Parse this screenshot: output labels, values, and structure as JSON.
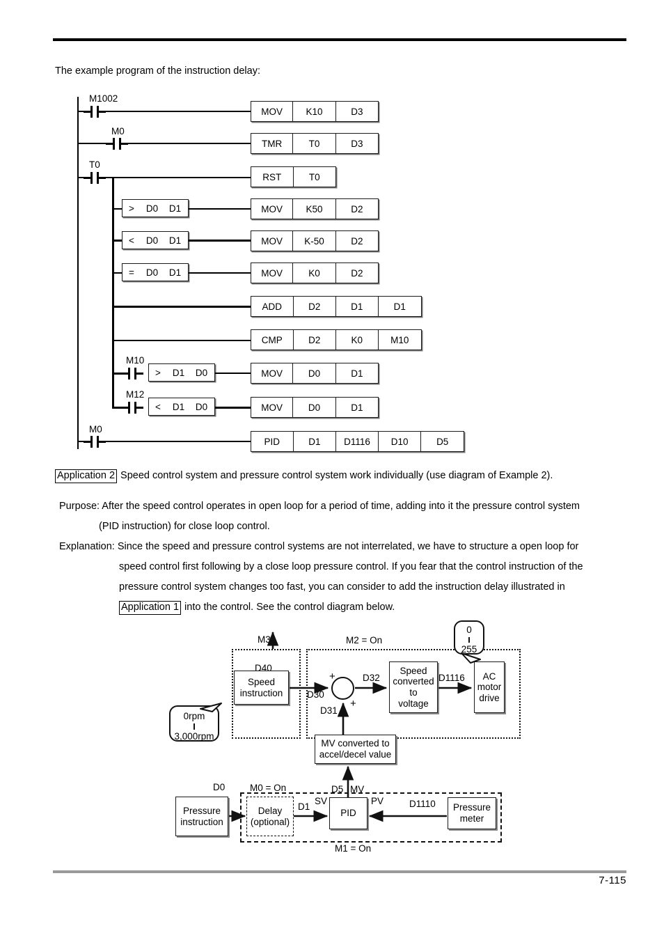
{
  "document": {
    "page_number": "7-115",
    "intro_text": "The example program of the instruction delay:"
  },
  "ladder": {
    "rungs": [
      {
        "contact_label": "M1002",
        "cells": [
          "MOV",
          "K10",
          "D3"
        ]
      },
      {
        "contact_label": "M0",
        "cells": [
          "TMR",
          "T0",
          "D3"
        ]
      },
      {
        "contact_label": "T0",
        "cells": [
          "RST",
          "T0"
        ]
      },
      {
        "contact_label": "",
        "compare": ">  D0   D1",
        "cells": [
          "MOV",
          "K50",
          "D2"
        ]
      },
      {
        "contact_label": "",
        "compare": "<  D0   D1",
        "cells": [
          "MOV",
          "K-50",
          "D2"
        ]
      },
      {
        "contact_label": "",
        "compare": "=  D0   D1",
        "cells": [
          "MOV",
          "K0",
          "D2"
        ]
      },
      {
        "contact_label": "",
        "cells": [
          "ADD",
          "D2",
          "D1",
          "D1"
        ]
      },
      {
        "contact_label": "",
        "cells": [
          "CMP",
          "D2",
          "K0",
          "M10"
        ]
      },
      {
        "contact_label": "M10",
        "compare": ">  D1   D0",
        "cells": [
          "MOV",
          "D0",
          "D1"
        ]
      },
      {
        "contact_label": "M12",
        "compare": "<  D1   D0",
        "cells": [
          "MOV",
          "D0",
          "D1"
        ]
      },
      {
        "contact_label": "M0",
        "cells": [
          "PID",
          "D1",
          "D1116",
          "D10",
          "D5"
        ]
      }
    ],
    "cell_labels": {
      "r1c1": "MOV",
      "r1c2": "K10",
      "r1c3": "D3",
      "r2c1": "TMR",
      "r2c2": "T0",
      "r2c3": "D3",
      "r3c1": "RST",
      "r3c2": "T0",
      "r4c1": "MOV",
      "r4c2": "K50",
      "r4c3": "D2",
      "r5c1": "MOV",
      "r5c2": "K-50",
      "r5c3": "D2",
      "r6c1": "MOV",
      "r6c2": "K0",
      "r6c3": "D2",
      "r7c1": "ADD",
      "r7c2": "D2",
      "r7c3": "D1",
      "r7c4": "D1",
      "r8c1": "CMP",
      "r8c2": "D2",
      "r8c3": "K0",
      "r8c4": "M10",
      "r9c1": "MOV",
      "r9c2": "D0",
      "r9c3": "D1",
      "r10c1": "MOV",
      "r10c2": "D0",
      "r10c3": "D1",
      "r11c1": "PID",
      "r11c2": "D1",
      "r11c3": "D1116",
      "r11c4": "D10",
      "r11c5": "D5"
    },
    "contacts": {
      "c1": "M1002",
      "c2": "M0",
      "c3": "T0",
      "c9": "M10",
      "c10": "M12",
      "c11": "M0"
    },
    "compare_boxes": {
      "b4_op": ">",
      "b4_a": "D0",
      "b4_b": "D1",
      "b5_op": "<",
      "b5_a": "D0",
      "b5_b": "D1",
      "b6_op": "=",
      "b6_a": "D0",
      "b6_b": "D1",
      "b9_op": ">",
      "b9_a": "D1",
      "b9_b": "D0",
      "b10_op": "<",
      "b10_a": "D1",
      "b10_b": "D0"
    }
  },
  "application2": {
    "tag": "Application 2",
    "headline": "Speed control system and pressure control system work individually (use diagram of Example 2).",
    "purpose_label": "Purpose:",
    "purpose_line1": "After the speed control operates in open loop for a period of time, adding into it the pressure control system",
    "purpose_line2": "(PID instruction) for close loop control.",
    "explanation_label": "Explanation:",
    "explanation_line1": "Since the speed and pressure control systems are not interrelated, we have to structure a open loop for",
    "explanation_line2": "speed control first following by a close loop pressure control. If you fear that the control instruction of the",
    "explanation_line3": "pressure control system changes too fast, you can consider to add the instruction delay illustrated in",
    "explanation_tag": "Application 1",
    "explanation_line4": "into the control. See the control diagram below."
  },
  "block_diagram": {
    "labels": {
      "m3": "M3",
      "m2_on": "M2 = On",
      "m0_on": "M0 = On",
      "m1_on": "M1 = On",
      "d40": "D40",
      "d30": "D30",
      "d31": "D31",
      "d32": "D32",
      "d1116": "D1116",
      "d0": "D0",
      "d1": "D1",
      "d5": "D5",
      "mv": "MV",
      "sv": "SV",
      "pv": "PV",
      "d1110": "D1110",
      "plus1": "+",
      "plus2": "+"
    },
    "boxes": {
      "speed_instruction": "Speed\ninstruction",
      "speed_instruction_l1": "Speed",
      "speed_instruction_l2": "instruction",
      "speed_converted_l1": "Speed",
      "speed_converted_l2": "converted",
      "speed_converted_l3": "to",
      "speed_converted_l4": "voltage",
      "ac_motor_l1": "AC",
      "ac_motor_l2": "motor",
      "ac_motor_l3": "drive",
      "mv_converted_l1": "MV converted to",
      "mv_converted_l2": "accel/decel value",
      "pressure_instruction_l1": "Pressure",
      "pressure_instruction_l2": "instruction",
      "delay_l1": "Delay",
      "delay_l2": "(optional)",
      "pid": "PID",
      "pressure_meter_l1": "Pressure",
      "pressure_meter_l2": "meter"
    },
    "callouts": {
      "rpm_top": "0rpm",
      "rpm_bottom": "3,000rpm",
      "range_top": "0",
      "range_bottom": "255"
    }
  },
  "colors": {
    "ink": "#000000",
    "footer_rule": "#9a9a9a",
    "box_shadow": "#888888"
  }
}
